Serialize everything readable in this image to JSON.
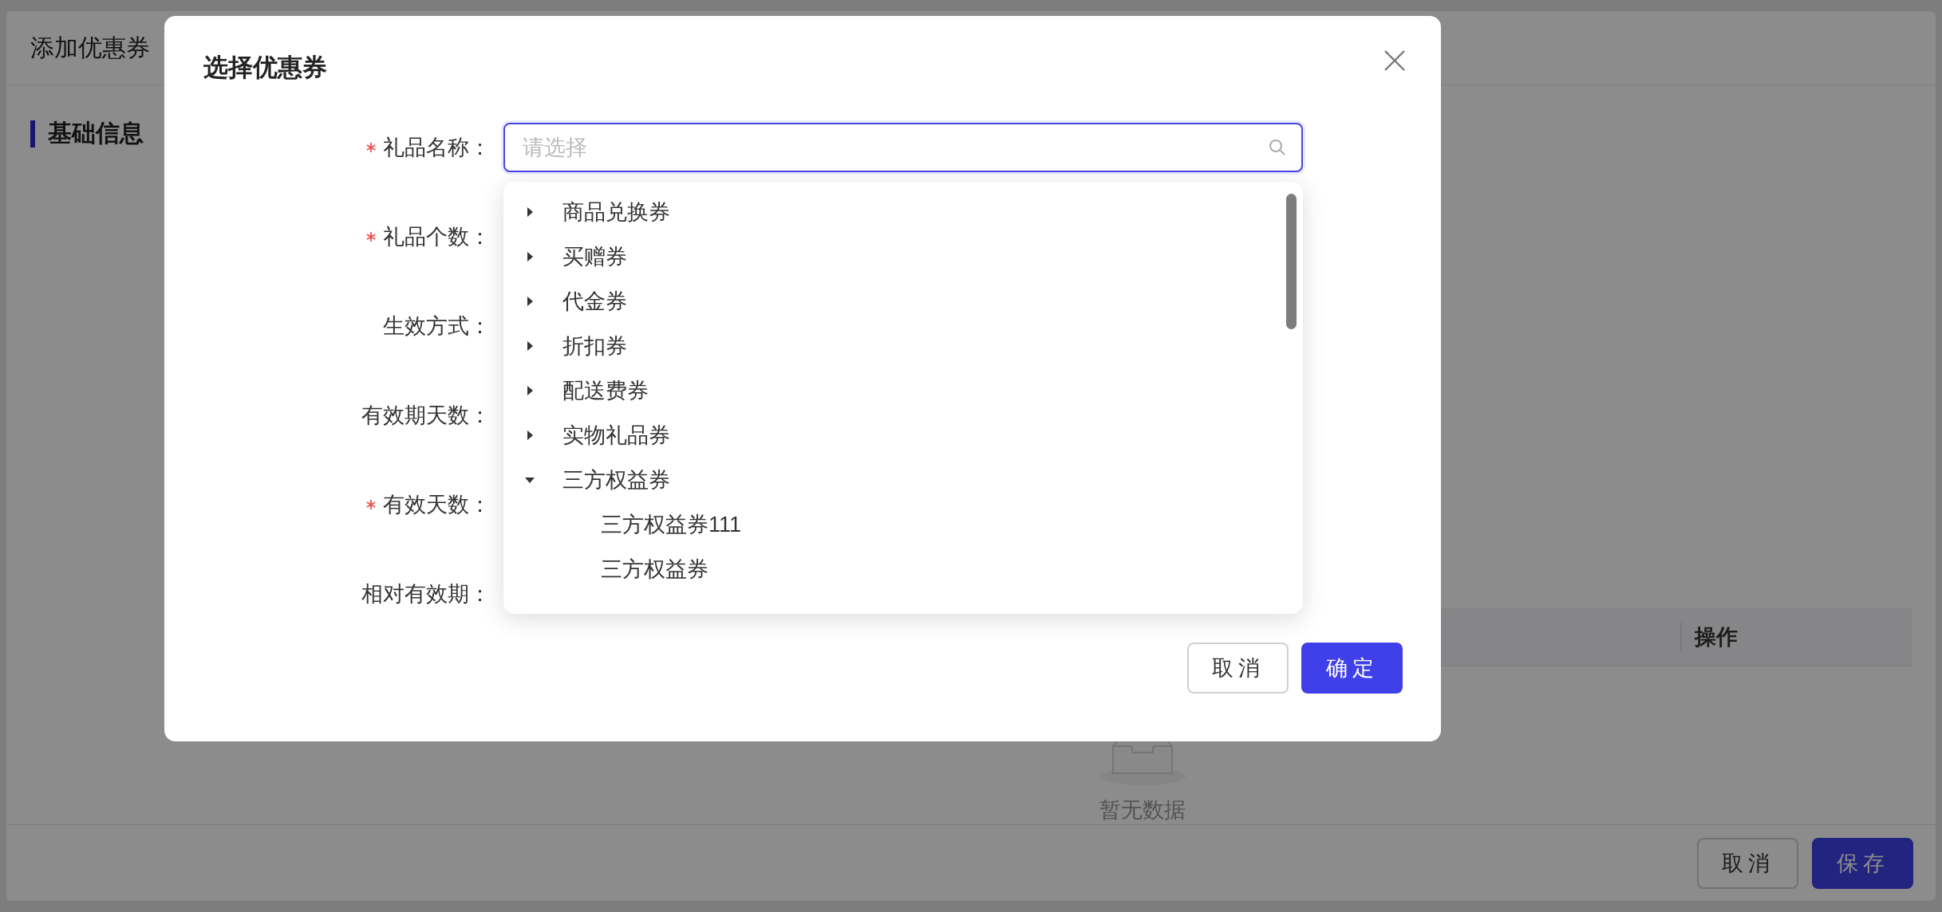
{
  "page": {
    "title": "添加优惠券",
    "section": "基础信息",
    "table": {
      "columns": [
        "操作"
      ]
    },
    "empty_text": "暂无数据",
    "buttons": [
      {
        "label": "取消",
        "kind": "default"
      },
      {
        "label": "保存",
        "kind": "primary"
      }
    ]
  },
  "dialog": {
    "title": "选择优惠券",
    "fields": [
      {
        "label": "礼品名称：",
        "required": true,
        "placeholder": "请选择"
      },
      {
        "label": "礼品个数：",
        "required": true
      },
      {
        "label": "生效方式：",
        "required": false
      },
      {
        "label": "有效期天数：",
        "required": false
      },
      {
        "label": "有效天数：",
        "required": true
      },
      {
        "label": "相对有效期：",
        "required": false
      }
    ],
    "tree": [
      {
        "label": "商品兑换券",
        "expanded": false
      },
      {
        "label": "买赠券",
        "expanded": false
      },
      {
        "label": "代金券",
        "expanded": false
      },
      {
        "label": "折扣券",
        "expanded": false
      },
      {
        "label": "配送费券",
        "expanded": false
      },
      {
        "label": "实物礼品券",
        "expanded": false
      },
      {
        "label": "三方权益券",
        "expanded": true,
        "children": [
          {
            "label": "三方权益券111"
          },
          {
            "label": "三方权益券"
          }
        ]
      }
    ],
    "buttons": [
      {
        "label": "取消",
        "kind": "default"
      },
      {
        "label": "确定",
        "kind": "primary"
      }
    ]
  }
}
